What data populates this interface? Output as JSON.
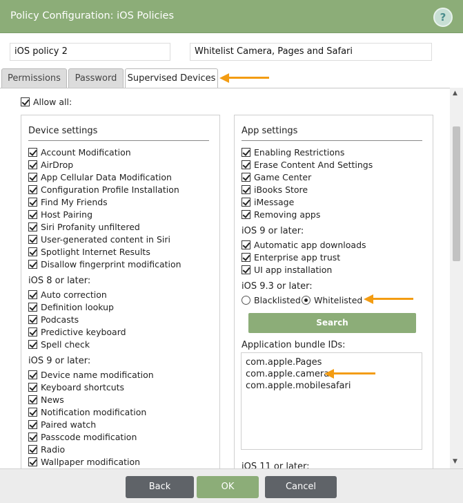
{
  "dialog": {
    "title": "Policy Configuration: iOS Policies",
    "help_label": "?"
  },
  "fields": {
    "policy_name": "iOS policy 2",
    "description": "Whitelist Camera, Pages and Safari"
  },
  "tabs": [
    {
      "label": "Permissions",
      "active": false
    },
    {
      "label": "Password",
      "active": false
    },
    {
      "label": "Supervised Devices",
      "active": true
    }
  ],
  "allow_all": {
    "label": "Allow all:",
    "checked": true
  },
  "device_settings": {
    "title": "Device settings",
    "items": [
      "Account Modification",
      "AirDrop",
      "App Cellular Data Modification",
      "Configuration Profile Installation",
      "Find My Friends",
      "Host Pairing",
      "Siri Profanity unfiltered",
      "User-generated content in Siri",
      "Spotlight Internet Results",
      "Disallow fingerprint modification"
    ],
    "ios8_heading": "iOS 8 or later:",
    "ios8_items": [
      "Auto correction",
      "Definition lookup",
      "Podcasts",
      "Predictive keyboard",
      "Spell check"
    ],
    "ios9_heading": "iOS 9 or later:",
    "ios9_items": [
      "Device name modification",
      "Keyboard shortcuts",
      "News",
      "Notification modification",
      "Paired watch",
      "Passcode modification",
      "Radio",
      "Wallpaper modification"
    ]
  },
  "app_settings": {
    "title": "App settings",
    "items": [
      "Enabling Restrictions",
      "Erase Content And Settings",
      "Game Center",
      "iBooks Store",
      "iMessage",
      "Removing apps"
    ],
    "ios9_heading": "iOS 9 or later:",
    "ios9_items": [
      "Automatic app downloads",
      "Enterprise app trust",
      "UI app installation"
    ],
    "ios93_heading": "iOS 9.3 or later:",
    "radio_blacklisted": "Blacklisted",
    "radio_whitelisted": "Whitelisted",
    "selected_mode": "Whitelisted",
    "search_label": "Search",
    "bundle_ids_heading": "Application bundle IDs:",
    "bundle_ids": [
      "com.apple.Pages",
      "com.apple.camera",
      "com.apple.mobilesafari"
    ],
    "ios11_heading": "iOS 11 or later:"
  },
  "footer": {
    "back_label": "Back",
    "ok_label": "OK",
    "cancel_label": "Cancel"
  },
  "colors": {
    "header_green": "#8cad78",
    "button_gray": "#5f6368",
    "arrow_orange": "#f39c12"
  }
}
